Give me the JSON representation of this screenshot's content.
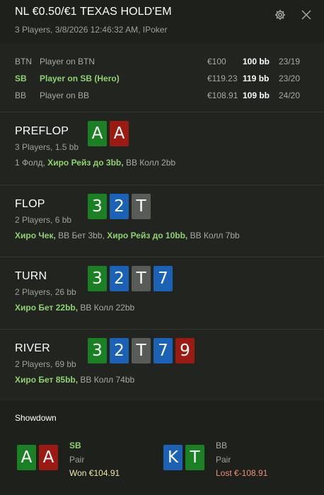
{
  "header": {
    "title": "NL €0.50/€1 TEXAS HOLD'EM",
    "subtitle": "3 Players, 3/8/2026 12:46:32 AM, IPoker",
    "icons": [
      "gear-icon",
      "close-icon"
    ]
  },
  "players": [
    {
      "position": "BTN",
      "name": "Player on BTN",
      "stack": "€100",
      "bb": "100 bb",
      "count": "23/19",
      "hero": false
    },
    {
      "position": "SB",
      "name": "Player on SB (Hero)",
      "stack": "€119.23",
      "bb": "119 bb",
      "count": "23/20",
      "hero": true
    },
    {
      "position": "BB",
      "name": "Player on BB",
      "stack": "€108.91",
      "bb": "109 bb",
      "count": "24/20",
      "hero": false
    }
  ],
  "streets": [
    {
      "name": "PREFLOP",
      "info": "3 Players, 1.5 bb",
      "cards": [
        {
          "rank": "A",
          "suit": "spades",
          "color": "#1b7f23"
        },
        {
          "rank": "A",
          "suit": "hearts",
          "color": "#9b1a12"
        }
      ],
      "actions": [
        {
          "text": "1 Фолд, ",
          "hero": false
        },
        {
          "text": "Хиро Рейз до 3bb,",
          "hero": true
        },
        {
          "text": " BB Колл 2bb",
          "hero": false
        }
      ]
    },
    {
      "name": "FLOP",
      "info": "2 Players, 6 bb",
      "cards": [
        {
          "rank": "3",
          "suit": "spades",
          "color": "#1b7f23"
        },
        {
          "rank": "2",
          "suit": "diamonds",
          "color": "#1b62b7"
        },
        {
          "rank": "T",
          "suit": "clubs",
          "color": "#595b58"
        }
      ],
      "actions": [
        {
          "text": "Хиро Чек,",
          "hero": true
        },
        {
          "text": " BB Бет 3bb, ",
          "hero": false
        },
        {
          "text": "Хиро Рейз до 10bb,",
          "hero": true
        },
        {
          "text": " BB Колл 7bb",
          "hero": false
        }
      ]
    },
    {
      "name": "TURN",
      "info": "2 Players, 26 bb",
      "cards": [
        {
          "rank": "3",
          "suit": "spades",
          "color": "#1b7f23"
        },
        {
          "rank": "2",
          "suit": "diamonds",
          "color": "#1b62b7"
        },
        {
          "rank": "T",
          "suit": "clubs",
          "color": "#595b58"
        },
        {
          "rank": "7",
          "suit": "diamonds",
          "color": "#1b62b7"
        }
      ],
      "actions": [
        {
          "text": "Хиро Бет 22bb,",
          "hero": true
        },
        {
          "text": " BB Колл 22bb",
          "hero": false
        }
      ]
    },
    {
      "name": "RIVER",
      "info": "2 Players, 69 bb",
      "cards": [
        {
          "rank": "3",
          "suit": "spades",
          "color": "#1b7f23"
        },
        {
          "rank": "2",
          "suit": "diamonds",
          "color": "#1b62b7"
        },
        {
          "rank": "T",
          "suit": "clubs",
          "color": "#595b58"
        },
        {
          "rank": "7",
          "suit": "diamonds",
          "color": "#1b62b7"
        },
        {
          "rank": "9",
          "suit": "hearts",
          "color": "#9b1a12"
        }
      ],
      "actions": [
        {
          "text": "Хиро Бет 85bb,",
          "hero": true
        },
        {
          "text": " BB Колл 74bb",
          "hero": false
        }
      ]
    }
  ],
  "showdown": {
    "title": "Showdown",
    "players": [
      {
        "position": "SB",
        "hand": "Pair",
        "result": "Won €104.91",
        "outcome": "won",
        "hero": true,
        "cards": [
          {
            "rank": "A",
            "suit": "spades",
            "color": "#1b7f23"
          },
          {
            "rank": "A",
            "suit": "hearts",
            "color": "#9b1a12"
          }
        ]
      },
      {
        "position": "BB",
        "hand": "Pair",
        "result": "Lost €-108.91",
        "outcome": "lost",
        "hero": false,
        "cards": [
          {
            "rank": "K",
            "suit": "diamonds",
            "color": "#1b62b7"
          },
          {
            "rank": "T",
            "suit": "spades",
            "color": "#1b7f23"
          }
        ]
      }
    ]
  },
  "colors": {
    "background": "#21241f",
    "hero_green": "#8fd36e",
    "won": "#f2e6a0",
    "lost": "#ef8e78"
  }
}
